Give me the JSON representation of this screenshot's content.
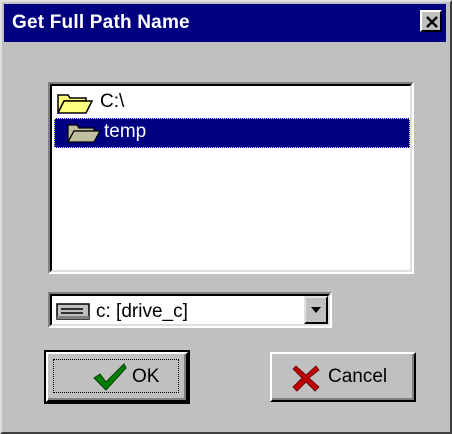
{
  "window": {
    "title": "Get Full Path Name"
  },
  "directory_list": {
    "items": [
      {
        "label": "C:\\",
        "icon": "open-folder-icon",
        "selected": false
      },
      {
        "label": "temp",
        "icon": "open-folder-icon",
        "selected": true
      }
    ]
  },
  "drive_select": {
    "value": "c: [drive_c]",
    "icon": "drive-icon"
  },
  "buttons": {
    "ok_label": "OK",
    "cancel_label": "Cancel"
  },
  "colors": {
    "titlebar": "#000080",
    "face": "#c0c0c0",
    "selection": "#000080",
    "ok_check": "#008000",
    "cancel_x": "#c00000"
  }
}
